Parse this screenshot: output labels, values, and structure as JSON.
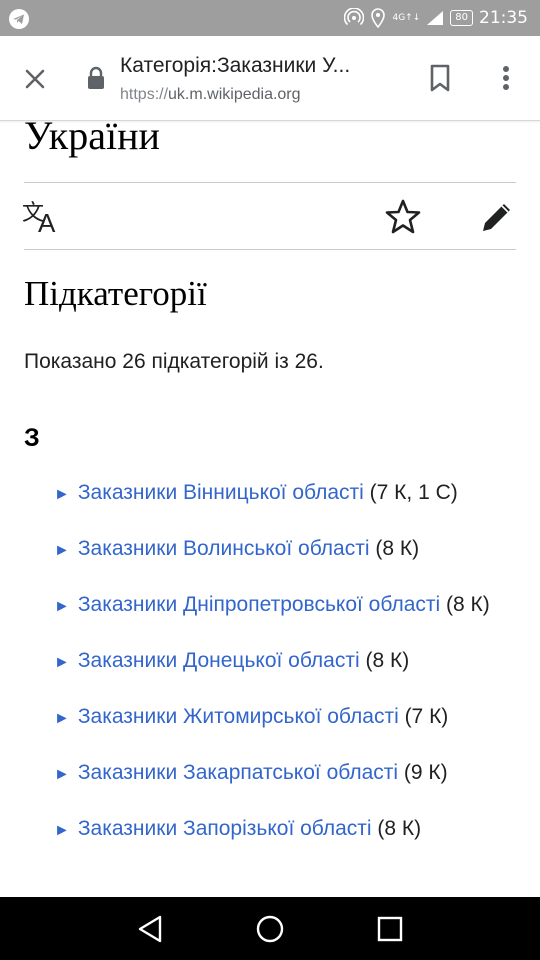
{
  "status_bar": {
    "time": "21:35",
    "battery": "80",
    "network": "4G↑↓",
    "icons": [
      "telegram-icon",
      "hotspot-icon",
      "location-icon",
      "signal-icon",
      "battery-icon"
    ]
  },
  "browser": {
    "title": "Категорія:Заказники У...",
    "url_scheme": "https://",
    "url_host": "uk.m.wikipedia.org",
    "icons": [
      "close-icon",
      "lock-icon",
      "bookmark-icon",
      "more-vert-icon"
    ]
  },
  "page": {
    "title": "України",
    "actions": [
      "language-icon",
      "watch-star-icon",
      "edit-pencil-icon"
    ],
    "section_heading": "Підкатегорії",
    "summary": "Показано 26 підкатегорій із 26.",
    "letter": "З",
    "bullet": "►",
    "categories": [
      {
        "link": "Заказники Вінницької області",
        "meta": " (7 К, 1 С)"
      },
      {
        "link": "Заказники Волинської області",
        "meta": " (8 К)"
      },
      {
        "link": "Заказники Дніпропетровської області",
        "meta": " (8 К)"
      },
      {
        "link": "Заказники Донецької області",
        "meta": " (8 К)"
      },
      {
        "link": "Заказники Житомирської області",
        "meta": " (7 К)"
      },
      {
        "link": "Заказники Закарпатської області",
        "meta": " (9 К)"
      },
      {
        "link": "Заказники Запорізької області",
        "meta": " (8 К)"
      }
    ]
  },
  "nav_bar": {
    "icons": [
      "back-icon",
      "home-icon",
      "recents-icon"
    ]
  },
  "colors": {
    "link": "#3366cc",
    "status_bar": "#9e9e9e",
    "nav_bar": "#000000",
    "divider": "#c8ccd1"
  }
}
